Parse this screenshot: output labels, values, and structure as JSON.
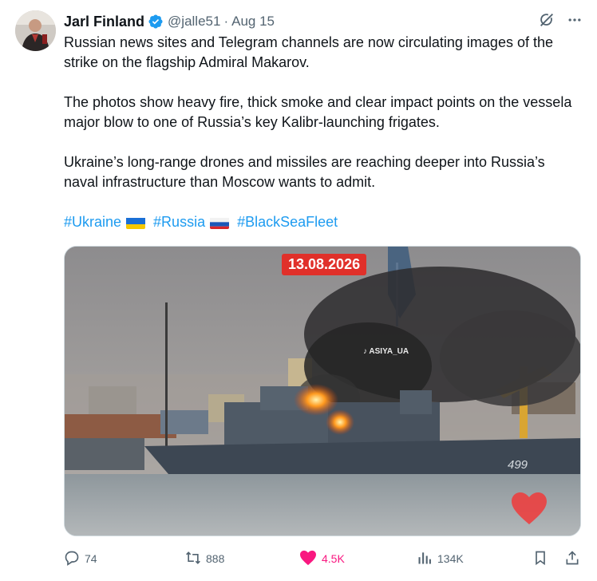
{
  "author": {
    "name": "Jarl Finland",
    "handle": "@jalle51",
    "separator": "·",
    "date": "Aug 15",
    "verified": true
  },
  "tweet": {
    "paragraphs": [
      "Russian news sites and Telegram channels are now circulating images of the strike on the flagship Admiral Makarov.",
      "The photos show heavy fire, thick smoke and clear impact points on the vessela major blow to one of Russia’s key Kalibr-launching frigates.",
      "Ukraine’s long-range drones and missiles are reaching deeper into Russia’s naval infrastructure than Moscow wants to admit."
    ],
    "hashtags": [
      {
        "tag": "#Ukraine",
        "flag": "ukraine"
      },
      {
        "tag": "#Russia",
        "flag": "russia"
      },
      {
        "tag": "#BlackSeaFleet",
        "flag": null
      }
    ]
  },
  "media": {
    "date_stamp": "13.08.2026",
    "watermark": "♪ ASIYA_UA",
    "hull_number": "499"
  },
  "actions": {
    "replies": "74",
    "reposts": "888",
    "likes": "4.5K",
    "views": "134K"
  },
  "colors": {
    "accent": "#1d9bf0",
    "like": "#f91880",
    "muted": "#536471",
    "text": "#0f1419",
    "date_stamp_bg": "#e0302a"
  },
  "icons": {
    "verified": "verified-badge-icon",
    "grok": "grok-icon",
    "more": "more-icon",
    "reply": "reply-icon",
    "repost": "repost-icon",
    "like": "heart-icon",
    "views": "views-icon",
    "bookmark": "bookmark-icon",
    "share": "share-icon"
  }
}
